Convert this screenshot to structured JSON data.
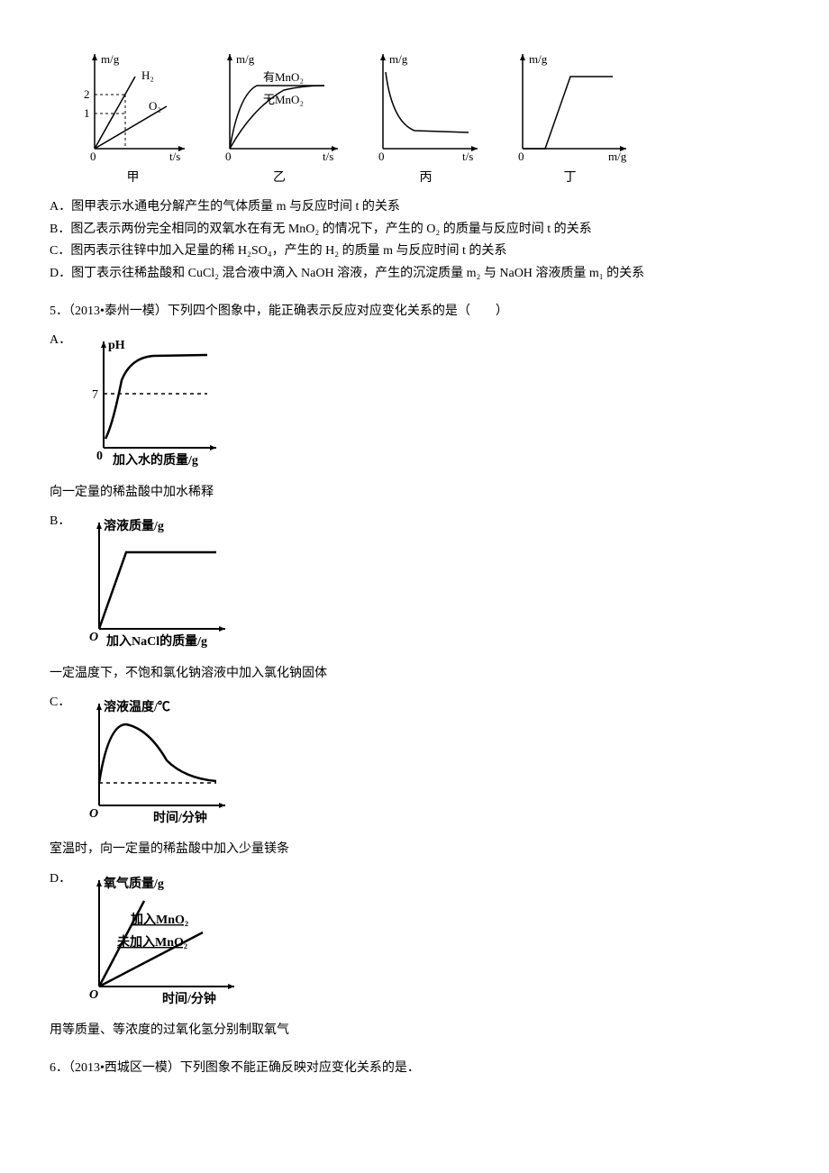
{
  "chart_data": [
    {
      "type": "line",
      "id": "jia",
      "label": "甲",
      "ylabel": "m/g",
      "xlabel": "t/s",
      "yticks": [
        1,
        2
      ],
      "series": [
        {
          "name": "H₂",
          "points": [
            [
              0,
              0
            ],
            [
              35,
              45
            ]
          ],
          "dash_ref": 35
        },
        {
          "name": "O₂",
          "points": [
            [
              0,
              0
            ],
            [
              60,
              35
            ]
          ],
          "dash_ref": 35
        }
      ]
    },
    {
      "type": "line",
      "id": "yi",
      "label": "乙",
      "ylabel": "m/g",
      "xlabel": "t/s",
      "series": [
        {
          "name": "有MnO₂",
          "curve": "fast-plateau"
        },
        {
          "name": "无MnO₂",
          "curve": "slow-plateau"
        }
      ]
    },
    {
      "type": "line",
      "id": "bing",
      "label": "丙",
      "ylabel": "m/g",
      "xlabel": "t/s",
      "series": [
        {
          "name": "",
          "curve": "decay"
        }
      ]
    },
    {
      "type": "line",
      "id": "ding",
      "label": "丁",
      "ylabel": "m/g",
      "xlabel": "m/g",
      "series": [
        {
          "name": "",
          "curve": "delayed-rise-plateau"
        }
      ]
    },
    {
      "type": "line",
      "id": "q5a",
      "ylabel": "pH",
      "xlabel": "加入水的质量/g",
      "yticks": [
        7
      ],
      "series": [
        {
          "name": "",
          "curve": "s-curve-approach"
        }
      ]
    },
    {
      "type": "line",
      "id": "q5b",
      "ylabel": "溶液质量/g",
      "xlabel": "加入NaCl的质量/g",
      "series": [
        {
          "name": "",
          "curve": "rise-plateau"
        }
      ]
    },
    {
      "type": "line",
      "id": "q5c",
      "ylabel": "溶液温度/℃",
      "xlabel": "时间/分钟",
      "series": [
        {
          "name": "",
          "curve": "peak-decline"
        }
      ]
    },
    {
      "type": "line",
      "id": "q5d",
      "ylabel": "氧气质量/g",
      "xlabel": "时间/分钟",
      "series": [
        {
          "name": "加入MnO₂",
          "curve": "steep"
        },
        {
          "name": "未加入MnO₂",
          "curve": "shallow"
        }
      ]
    }
  ],
  "q4_labels": {
    "jia": "甲",
    "yi": "乙",
    "bing": "丙",
    "ding": "丁"
  },
  "q4_options": {
    "A": "A．图甲表示水通电分解产生的气体质量 m 与反应时间 t 的关系",
    "B": "B．图乙表示两份完全相同的双氧水在有无 MnO₂ 的情况下，产生的 O₂ 的质量与反应时间 t 的关系",
    "C": "C．图丙表示往锌中加入足量的稀 H₂SO₄，产生的 H₂ 的质量 m 与反应时间 t 的关系",
    "D": "D．图丁表示往稀盐酸和 CuCl₂ 混合液中滴入 NaOH 溶液，产生的沉淀质量 m₂ 与 NaOH 溶液质量 m₁ 的关系"
  },
  "q5": {
    "stem": "5．（2013•泰州一模）下列四个图象中，能正确表示反应对应变化关系的是（　　）",
    "A_desc": "向一定量的稀盐酸中加水稀释",
    "B_desc": "一定温度下，不饱和氯化钠溶液中加入氯化钠固体",
    "C_desc": "室温时，向一定量的稀盐酸中加入少量镁条",
    "D_desc": "用等质量、等浓度的过氧化氢分别制取氧气",
    "A_ylabel": "pH",
    "A_xlabel": "加入水的质量/g",
    "A_ytick": "7",
    "B_ylabel": "溶液质量/g",
    "B_xlabel": "加入NaCl的质量/g",
    "C_ylabel": "溶液温度/℃",
    "C_xlabel": "时间/分钟",
    "D_ylabel": "氧气质量/g",
    "D_xlabel": "时间/分钟",
    "D_ser1": "加入MnO₂",
    "D_ser2": "未加入MnO₂",
    "letters": {
      "A": "A．",
      "B": "B．",
      "C": "C．",
      "D": "D．"
    }
  },
  "q6": {
    "stem": "6．（2013•西城区一模）下列图象不能正确反映对应变化关系的是．"
  },
  "axis": {
    "mg": "m/g",
    "ts": "t/s",
    "H2": "H₂",
    "O2": "O₂",
    "youMnO2": "有MnO₂",
    "wuMnO2": "无MnO₂",
    "zero": "0",
    "one": "1",
    "two": "2",
    "O": "O"
  }
}
